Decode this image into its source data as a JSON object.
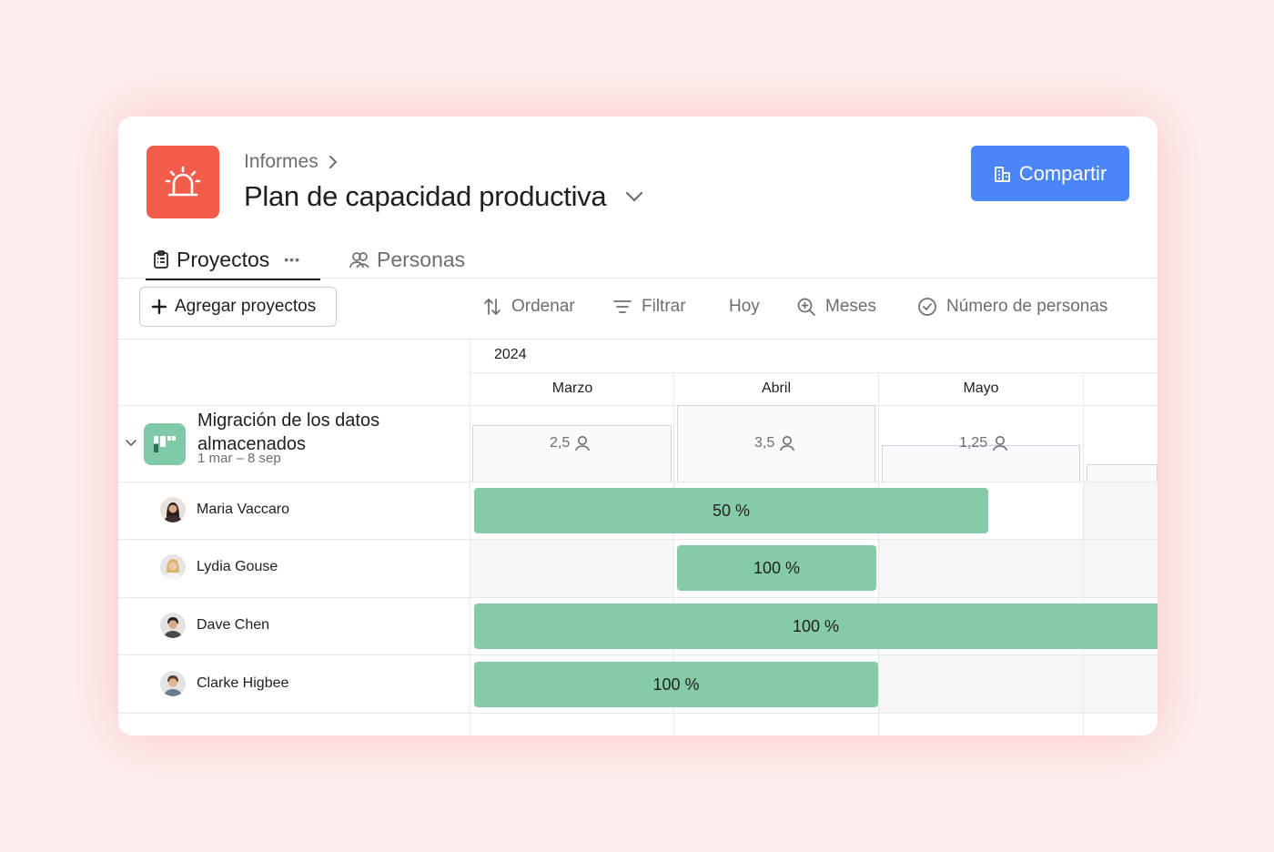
{
  "header": {
    "breadcrumb": "Informes",
    "title": "Plan de capacidad productiva",
    "share_label": "Compartir"
  },
  "tabs": [
    {
      "label": "Proyectos",
      "more": "•••"
    },
    {
      "label": "Personas"
    }
  ],
  "toolbar": {
    "add_label": "Agregar proyectos",
    "sort_label": "Ordenar",
    "filter_label": "Filtrar",
    "today_label": "Hoy",
    "zoom_label": "Meses",
    "count_label": "Número de personas"
  },
  "timeline": {
    "year": "2024",
    "months": [
      "Marzo",
      "Abril",
      "Mayo"
    ]
  },
  "project": {
    "name_line1": "Migración de los datos",
    "name_line2": "almacenados",
    "dates": "1 mar – 8 sep",
    "capacity": [
      "2,5",
      "3,5",
      "1,25"
    ]
  },
  "people": [
    {
      "name": "Maria Vaccaro",
      "allocation": "50 %"
    },
    {
      "name": "Lydia Gouse",
      "allocation": "100 %"
    },
    {
      "name": "Dave Chen",
      "allocation": "100 %"
    },
    {
      "name": "Clarke Higbee",
      "allocation": "100 %"
    }
  ],
  "colors": {
    "brand_red": "#f25d4b",
    "button_blue": "#4a86f7",
    "bar_green": "#85cba8",
    "project_icon_green": "#7fc9a8"
  }
}
